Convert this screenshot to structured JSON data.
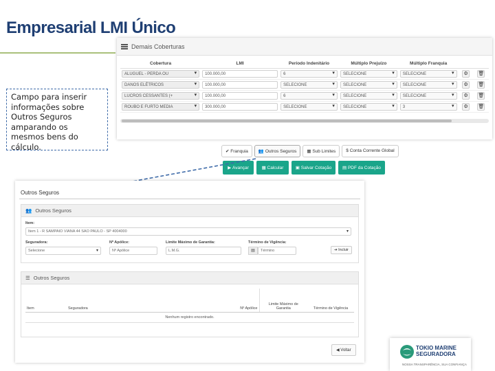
{
  "slide": {
    "title": "Empresarial LMI Único",
    "callout": "Campo para inserir informações sobre Outros Seguros amparando os mesmos bens do cálculo."
  },
  "coverages_panel": {
    "header": "Demais Coberturas",
    "columns": [
      "Cobertura",
      "LMI",
      "Período Indenitário",
      "Múltiplo Prejuízo",
      "Múltiplo Franquia"
    ],
    "rows": [
      {
        "coverage": "ALUGUEL - PERDA OU",
        "lmi": "100.000,00",
        "period": "6",
        "multiple": "SELECIONE",
        "franchise": "SELECIONE"
      },
      {
        "coverage": "DANOS ELÉTRICOS",
        "lmi": "100.000,00",
        "period": "SELECIONE",
        "multiple": "SELECIONE",
        "franchise": "SELECIONE"
      },
      {
        "coverage": "LUCROS CESSANTES (+",
        "lmi": "100.000,00",
        "period": "6",
        "multiple": "SELECIONE",
        "franchise": "SELECIONE"
      },
      {
        "coverage": "ROUBO E FURTO MEDIA",
        "lmi": "300.000,00",
        "period": "SELECIONE",
        "multiple": "SELECIONE",
        "franchise": "3"
      }
    ]
  },
  "tabs": [
    "Franquia",
    "Outros Seguros",
    "Sub Limites",
    "Conta Corrente Global"
  ],
  "actions": [
    "Avançar",
    "Calcular",
    "Salvar Cotação",
    "PDF da Cotação"
  ],
  "other_insurance_panel": {
    "page_title": "Outros Seguros",
    "card1_title": "Outros Seguros",
    "item_label": "Item:",
    "item_value": "Item 1 - R SAMPAIO VIANA 44 SAO PAULO - SP 4004000",
    "insurer_label": "Seguradora:",
    "insurer_value": "Selecione",
    "policy_label": "Nº Apólice:",
    "policy_placeholder": "Nº Apólice",
    "limit_label": "Limite Máximo de Garantia:",
    "limit_placeholder": "L.M.G.",
    "end_label": "Término de Vigência:",
    "end_placeholder": "Término",
    "include_button": "Incluir",
    "card2_title": "Outros Seguros",
    "table_headers": [
      "Item",
      "Seguradora",
      "Nº Apólice",
      "Limite Máximo de Garantia",
      "Término de Vigência"
    ],
    "empty_message": "Nenhum registro encontrado.",
    "back_button": "Voltar"
  },
  "logo": {
    "line1": "TOKIO MARINE",
    "line2": "SEGURADORA",
    "tagline": "NOSSA TRANSPARÊNCIA, SUA CONFIANÇA"
  },
  "colors": {
    "title": "#1f3f73",
    "accent_green": "#1aa58a",
    "callout_border": "#3d6aa8"
  }
}
